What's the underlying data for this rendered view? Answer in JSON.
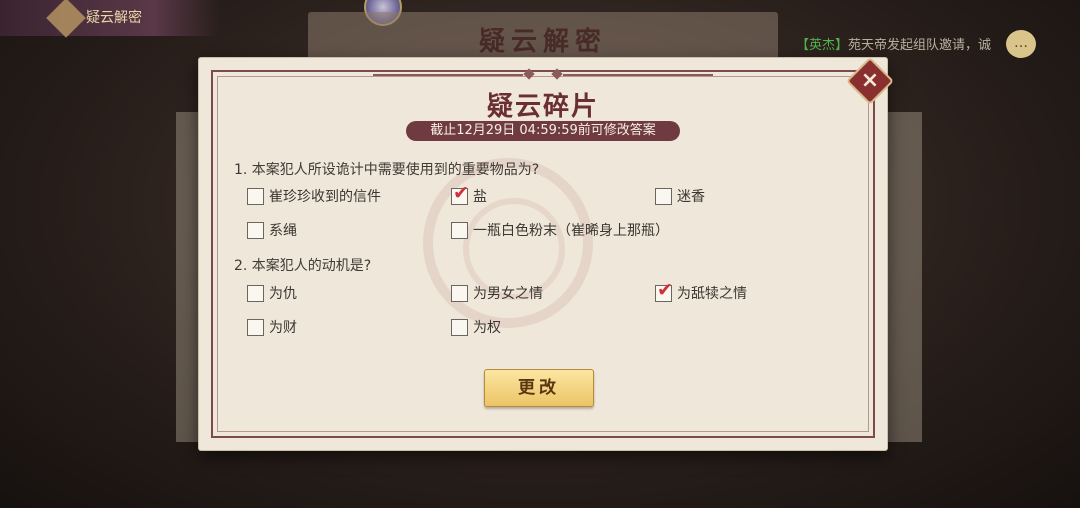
{
  "background": {
    "banner_title": "疑云解密",
    "board_title": "疑云解密",
    "chat_tag": "【英杰】",
    "chat_text": "苑天帝发起组队邀请，诚",
    "chat_icon": "speech-bubble-icon"
  },
  "dialog": {
    "title": "疑云碎片",
    "deadline": "截止12月29日 04:59:59前可修改答案",
    "close_icon": "×",
    "questions": [
      {
        "text": "1. 本案犯人所设诡计中需要使用到的重要物品为?",
        "options": [
          {
            "label": "崔珍珍收到的信件",
            "checked": false
          },
          {
            "label": "盐",
            "checked": true
          },
          {
            "label": "迷香",
            "checked": false
          },
          {
            "label": "系绳",
            "checked": false
          },
          {
            "label": "一瓶白色粉末（崔晞身上那瓶）",
            "checked": false
          }
        ]
      },
      {
        "text": "2. 本案犯人的动机是?",
        "options": [
          {
            "label": "为仇",
            "checked": false
          },
          {
            "label": "为男女之情",
            "checked": false
          },
          {
            "label": "为舐犊之情",
            "checked": true
          },
          {
            "label": "为财",
            "checked": false
          },
          {
            "label": "为权",
            "checked": false
          }
        ]
      }
    ],
    "check_mark": "✔",
    "submit_label": "更改"
  },
  "colors": {
    "panel": "#efe7d9",
    "accent": "#6f3b40",
    "check": "#d0303a",
    "button": "#ecc466"
  }
}
